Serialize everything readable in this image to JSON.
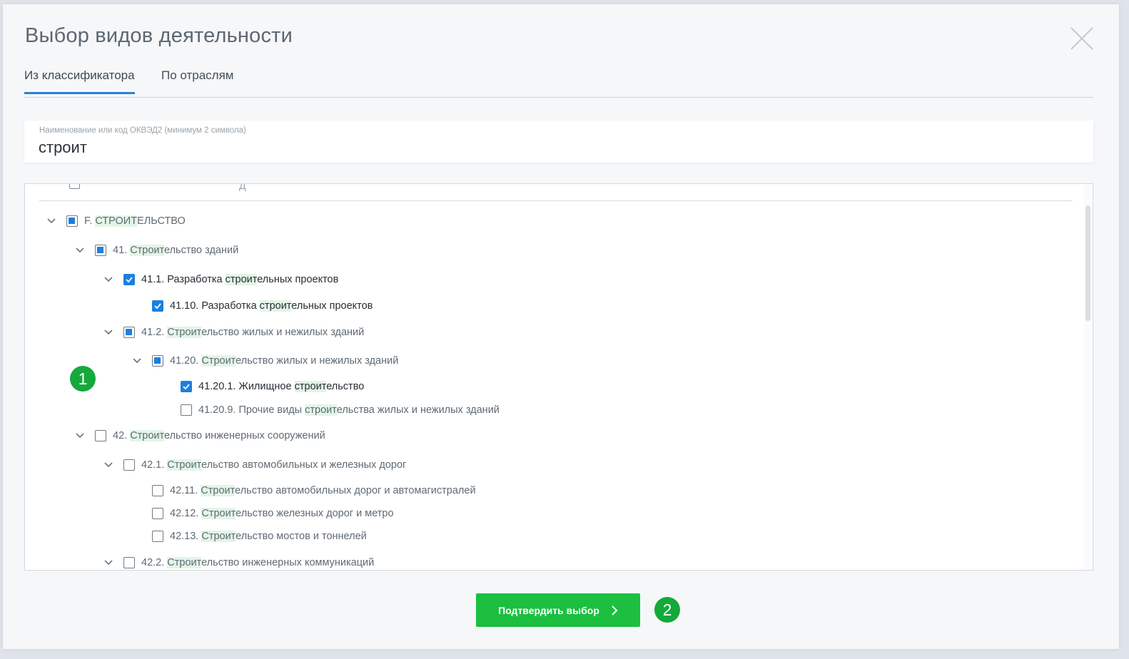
{
  "dialog": {
    "title": "Выбор видов деятельности",
    "close_icon": "close-icon"
  },
  "tabs": [
    {
      "label": "Из классификатора",
      "active": true
    },
    {
      "label": "По отраслям",
      "active": false
    }
  ],
  "search": {
    "label": "Наименование или код ОКВЭД2 (минимум 2 символа)",
    "value": "строит"
  },
  "tree": {
    "items": [
      {
        "code": "F.",
        "pre": "",
        "match": "СТРОИТ",
        "post": "ЕЛЬСТВО",
        "state": "partial",
        "expandable": true
      },
      {
        "code": "41.",
        "pre": "",
        "match": "Строит",
        "post": "ельство зданий",
        "state": "partial",
        "expandable": true
      },
      {
        "code": "41.1.",
        "pre": "Разработка ",
        "match": "строит",
        "post": "ельных проектов",
        "state": "checked",
        "expandable": true
      },
      {
        "code": "41.10.",
        "pre": "Разработка ",
        "match": "строит",
        "post": "ельных проектов",
        "state": "checked",
        "expandable": false
      },
      {
        "code": "41.2.",
        "pre": "",
        "match": "Строит",
        "post": "ельство жилых и нежилых зданий",
        "state": "partial",
        "expandable": true
      },
      {
        "code": "41.20.",
        "pre": "",
        "match": "Строит",
        "post": "ельство жилых и нежилых зданий",
        "state": "partial",
        "expandable": true
      },
      {
        "code": "41.20.1.",
        "pre": "Жилищное ",
        "match": "строит",
        "post": "ельство",
        "state": "checked",
        "expandable": false
      },
      {
        "code": "41.20.9.",
        "pre": "Прочие виды ",
        "match": "строит",
        "post": "ельства жилых и нежилых зданий",
        "state": "unchecked",
        "expandable": false
      },
      {
        "code": "42.",
        "pre": "",
        "match": "Строит",
        "post": "ельство инженерных сооружений",
        "state": "unchecked",
        "expandable": true
      },
      {
        "code": "42.1.",
        "pre": "",
        "match": "Строит",
        "post": "ельство автомобильных и железных дорог",
        "state": "unchecked",
        "expandable": true
      },
      {
        "code": "42.11.",
        "pre": "",
        "match": "Строит",
        "post": "ельство автомобильных дорог и автомагистралей",
        "state": "unchecked",
        "expandable": false
      },
      {
        "code": "42.12.",
        "pre": "",
        "match": "Строит",
        "post": "ельство железных дорог и метро",
        "state": "unchecked",
        "expandable": false
      },
      {
        "code": "42.13.",
        "pre": "",
        "match": "Строит",
        "post": "ельство мостов и тоннелей",
        "state": "unchecked",
        "expandable": false
      },
      {
        "code": "42.2.",
        "pre": "",
        "match": "Строит",
        "post": "ельство инженерных коммуникаций",
        "state": "unchecked",
        "expandable": true
      }
    ],
    "partial_top_text": "Д"
  },
  "confirm": {
    "label": "Подтвердить выбор",
    "icon": "chevron-right-icon"
  },
  "markers": [
    "1",
    "2"
  ],
  "colors": {
    "accent": "#1c7fe0",
    "confirm": "#1cbf40",
    "highlight": "#e3f5e6",
    "marker": "#14a93a"
  }
}
